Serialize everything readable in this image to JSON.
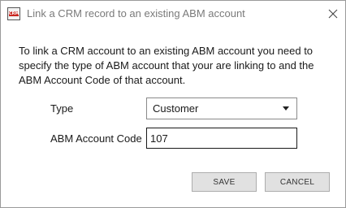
{
  "window": {
    "title": "Link a CRM record to an existing ABM account",
    "icon": "crm-app-icon",
    "icon_text": "CRM"
  },
  "form": {
    "intro": "To link a CRM account to an existing ABM account you need to specify the type of ABM account that your are linking to and the ABM Account Code of that account.",
    "type_label": "Type",
    "type_value": "Customer",
    "code_label": "ABM Account Code",
    "code_value": "107"
  },
  "buttons": {
    "save": "SAVE",
    "cancel": "CANCEL"
  }
}
